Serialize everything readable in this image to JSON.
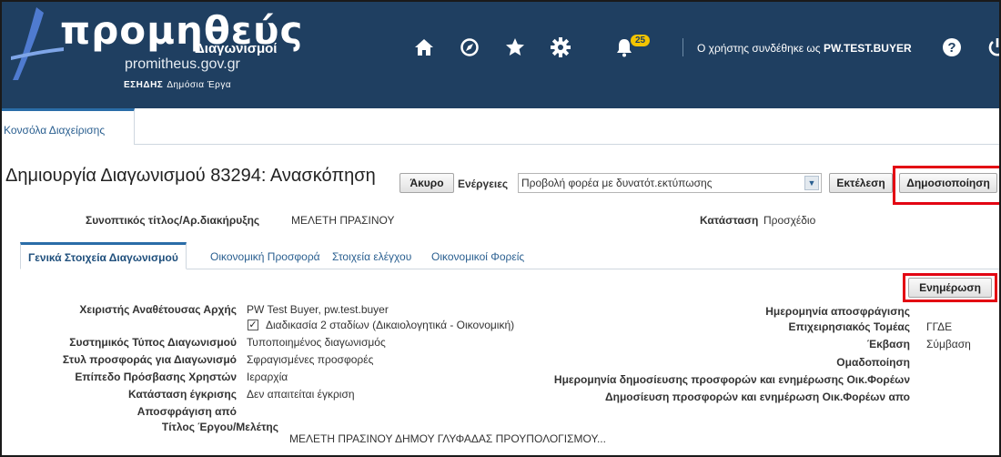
{
  "header": {
    "logo_main": "προμηθεύς",
    "logo_sub": "Διαγωνισμοί",
    "logo_domain": "promitheus.gov.gr",
    "logo_esidis": "ΕΣΗΔΗΣ",
    "logo_esidis_sub": "Δημόσια Έργα",
    "notification_count": "25",
    "user_prefix": "Ο χρήστης συνδέθηκε ως",
    "user_name": "PW.TEST.BUYER",
    "colors": {
      "background": "#1f3f61",
      "badge": "#f2c300"
    },
    "icons": [
      "home-icon",
      "compass-icon",
      "star-icon",
      "gear-icon",
      "bell-icon",
      "help-icon",
      "power-icon"
    ]
  },
  "topbar": {
    "console_tab": "Κονσόλα Διαχείρισης"
  },
  "page": {
    "title": "Δημιουργία Διαγωνισμού 83294: Ανασκόπηση",
    "cancel_label": "Άκυρο",
    "actions_label": "Ενέργειες",
    "actions_selected": "Προβολή φορέα με δυνατότ.εκτύπωσης",
    "execute_label": "Εκτέλεση",
    "publish_label": "Δημοσιοποίηση",
    "summary_label": "Συνοπτικός τίτλος/Αρ.διακήρυξης",
    "summary_value": "ΜΕΛΕΤΗ ΠΡΑΣΙΝΟΥ",
    "status_label": "Κατάσταση",
    "status_value": "Προσχέδιο",
    "highlight_color": "#e30613"
  },
  "tabs": [
    {
      "label": "Γενικά Στοιχεία Διαγωνισμού",
      "active": true
    },
    {
      "label": "Οικονομική Προσφορά",
      "active": false
    },
    {
      "label": "Στοιχεία ελέγχου",
      "active": false
    },
    {
      "label": "Οικονομικοί Φορείς",
      "active": false
    }
  ],
  "update_label": "Ενημέρωση",
  "form_left": [
    {
      "label": "Χειριστής Αναθέτουσας Αρχής",
      "value": "PW Test Buyer, pw.test.buyer"
    },
    {
      "label": "",
      "value": "Διαδικασία 2 σταδίων (Δικαιολογητικά - Οικονομική)",
      "checked": true
    },
    {
      "label": "Συστημικός Τύπος Διαγωνισμού",
      "value": "Τυποποιημένος διαγωνισμός"
    },
    {
      "label": "Στυλ προσφοράς για Διαγωνισμό",
      "value": "Σφραγισμένες προσφορές"
    },
    {
      "label": "Επίπεδο Πρόσβασης Χρηστών",
      "value": "Ιεραρχία"
    },
    {
      "label": "Κατάσταση έγκρισης",
      "value": "Δεν απαιτείται έγκριση"
    },
    {
      "label": "Αποσφράγιση από",
      "value": ""
    },
    {
      "label": "Τίτλος Έργου/Μελέτης",
      "value": "ΜΕΛΕΤΗ ΠΡΑΣΙΝΟΥ ΔΗΜΟΥ ΓΛΥΦΑΔΑΣ ΠΡΟΥΠΟΛΟΓΙΣΜΟΥ..."
    }
  ],
  "form_right": [
    {
      "label": "Ημερομηνία αποσφράγισης",
      "value": ""
    },
    {
      "label": "Επιχειρησιακός Τομέας",
      "value": "ΓΓΔΕ"
    },
    {
      "label": "Έκβαση",
      "value": "Σύμβαση"
    },
    {
      "label": "Ομαδοποίηση",
      "value": ""
    },
    {
      "label": "Ημερομηνία δημοσίευσης προσφορών και ενημέρωσης Οικ.Φορέων",
      "value": ""
    },
    {
      "label": "Δημοσίευση προσφορών και ενημέρωση Οικ.Φορέων απο",
      "value": ""
    }
  ]
}
